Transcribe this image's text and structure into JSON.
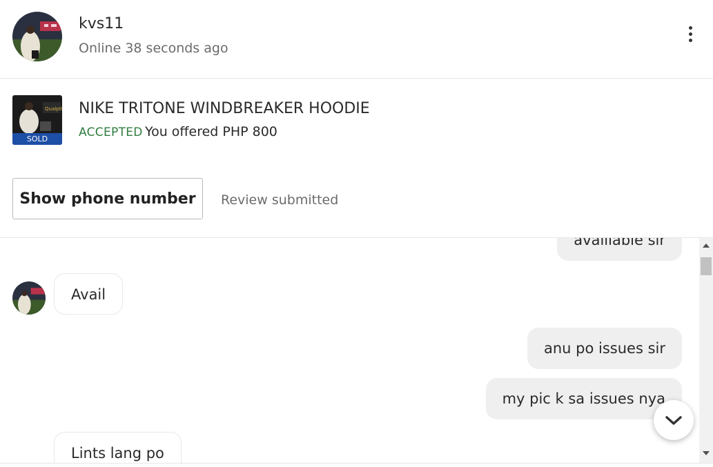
{
  "header": {
    "username": "kvs11",
    "status": "Online 38 seconds ago",
    "avatar_icon": "user-avatar",
    "menu_icon": "kebab-menu-icon"
  },
  "product": {
    "title": "NIKE TRITONE WINDBREAKER HOODIE",
    "badge": "SOLD",
    "offer_status": "ACCEPTED",
    "offer_text": "You offered PHP 800"
  },
  "actions": {
    "phone_button": "Show phone number",
    "review_status": "Review submitted"
  },
  "messages": [
    {
      "direction": "outgoing",
      "text": "availlable sir"
    },
    {
      "direction": "incoming",
      "text": "Avail"
    },
    {
      "direction": "outgoing",
      "text": "anu po issues sir"
    },
    {
      "direction": "outgoing",
      "text": "my pic k sa issues nya"
    },
    {
      "direction": "incoming",
      "text": "Lints lang po"
    }
  ],
  "colors": {
    "accepted": "#2f7d3f",
    "sold_badge": "#1e4fa6",
    "outgoing_bubble": "#efefef"
  }
}
